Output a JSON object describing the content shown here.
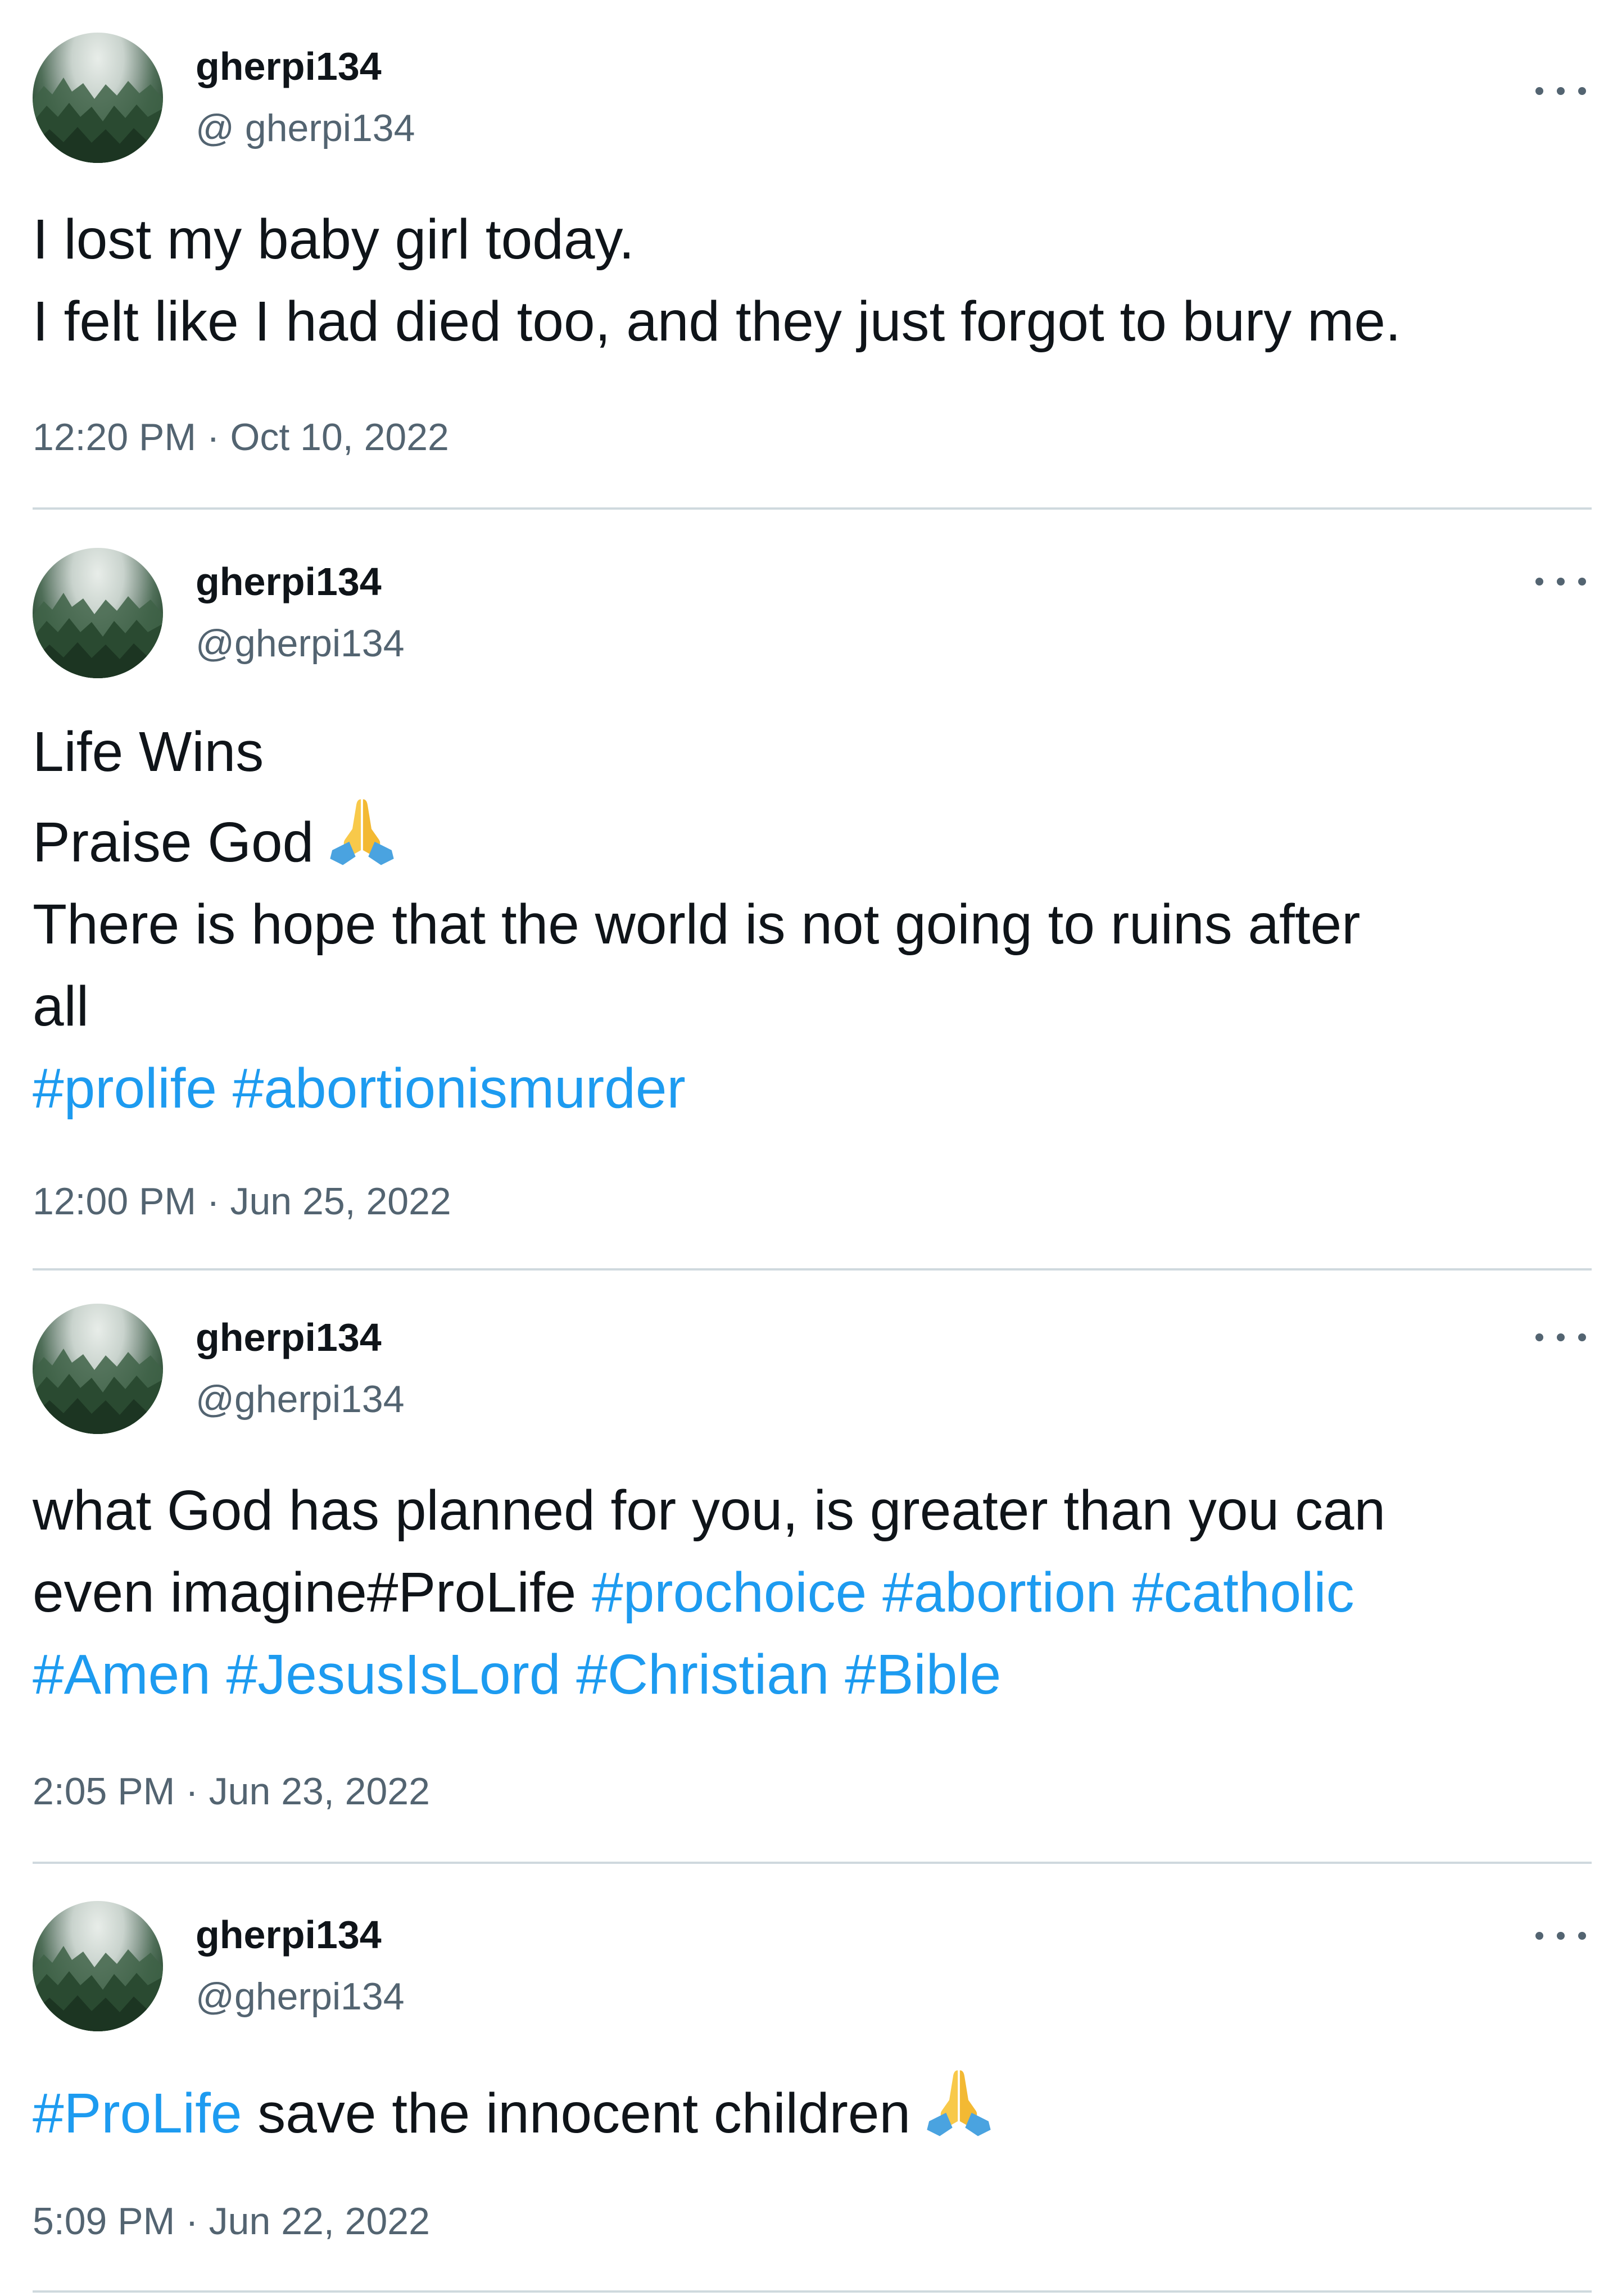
{
  "tweets": [
    {
      "display_name": "gherpi134",
      "handle": "@ gherpi134",
      "lines": [
        [
          {
            "t": "I lost my baby girl today."
          }
        ],
        [
          {
            "t": "I felt like I had died too, and they just forgot to bury me."
          }
        ]
      ],
      "timestamp": "12:20 PM · Oct 10, 2022",
      "avatar_icon": "misty-forest-avatar",
      "more_icon": "more-options-icon"
    },
    {
      "display_name": "gherpi134",
      "handle": "@gherpi134",
      "lines": [
        [
          {
            "t": "Life Wins"
          }
        ],
        [
          {
            "t": "Praise God"
          },
          {
            "emoji": "folded-hands"
          }
        ],
        [
          {
            "t": "There is hope that the world is not going to ruins after"
          }
        ],
        [
          {
            "t": "all"
          }
        ],
        [
          {
            "t": "#prolife",
            "tag": true
          },
          {
            "t": " "
          },
          {
            "t": "#abortionismurder",
            "tag": true
          }
        ]
      ],
      "timestamp": "12:00 PM · Jun 25, 2022",
      "avatar_icon": "misty-forest-avatar",
      "more_icon": "more-options-icon"
    },
    {
      "display_name": "gherpi134",
      "handle": "@gherpi134",
      "lines": [
        [
          {
            "t": "what God has planned for you, is greater than you can"
          }
        ],
        [
          {
            "t": "even imagine#ProLife "
          },
          {
            "t": "#prochoice",
            "tag": true
          },
          {
            "t": " "
          },
          {
            "t": "#abortion",
            "tag": true
          },
          {
            "t": " "
          },
          {
            "t": "#catholic",
            "tag": true
          }
        ],
        [
          {
            "t": "#Amen",
            "tag": true
          },
          {
            "t": " "
          },
          {
            "t": "#JesusIsLord",
            "tag": true
          },
          {
            "t": " "
          },
          {
            "t": "#Christian",
            "tag": true
          },
          {
            "t": " "
          },
          {
            "t": "#Bible",
            "tag": true
          }
        ]
      ],
      "timestamp": "2:05 PM · Jun 23, 2022",
      "avatar_icon": "misty-forest-avatar",
      "more_icon": "more-options-icon"
    },
    {
      "display_name": "gherpi134",
      "handle": "@gherpi134",
      "lines": [
        [
          {
            "t": "#ProLife",
            "tag": true
          },
          {
            "t": " save the innocent children"
          },
          {
            "emoji": "folded-hands"
          }
        ]
      ],
      "timestamp": "5:09 PM · Jun 22, 2022",
      "avatar_icon": "misty-forest-avatar",
      "more_icon": "more-options-icon"
    }
  ],
  "colors": {
    "text": "#0f1419",
    "secondary": "#536471",
    "hashtag": "#1d9bf0",
    "divider": "#cfd9de"
  }
}
